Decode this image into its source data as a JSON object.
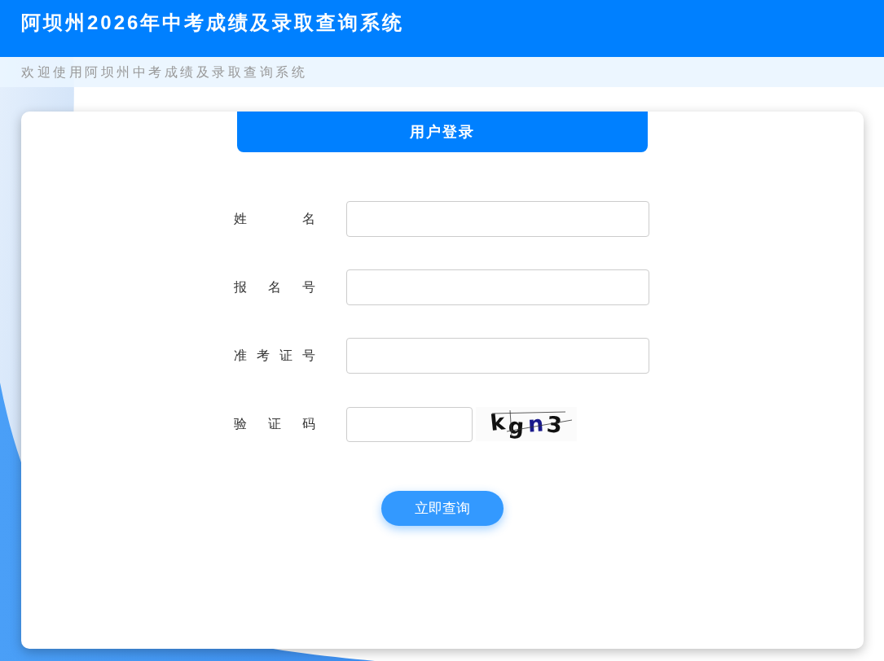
{
  "header": {
    "title": "阿坝州2026年中考成绩及录取查询系统",
    "subtitle": "欢迎使用阿坝州中考成绩及录取查询系统"
  },
  "login": {
    "tab": "用户登录",
    "fields": [
      {
        "kind": "text",
        "label": "姓 名"
      },
      {
        "kind": "text",
        "label": "报 名 号"
      },
      {
        "kind": "text",
        "label": "准 考 证 号"
      },
      {
        "kind": "captcha",
        "label": "验 证 码",
        "captcha": "kgn3"
      }
    ],
    "submit": "立即查询"
  }
}
